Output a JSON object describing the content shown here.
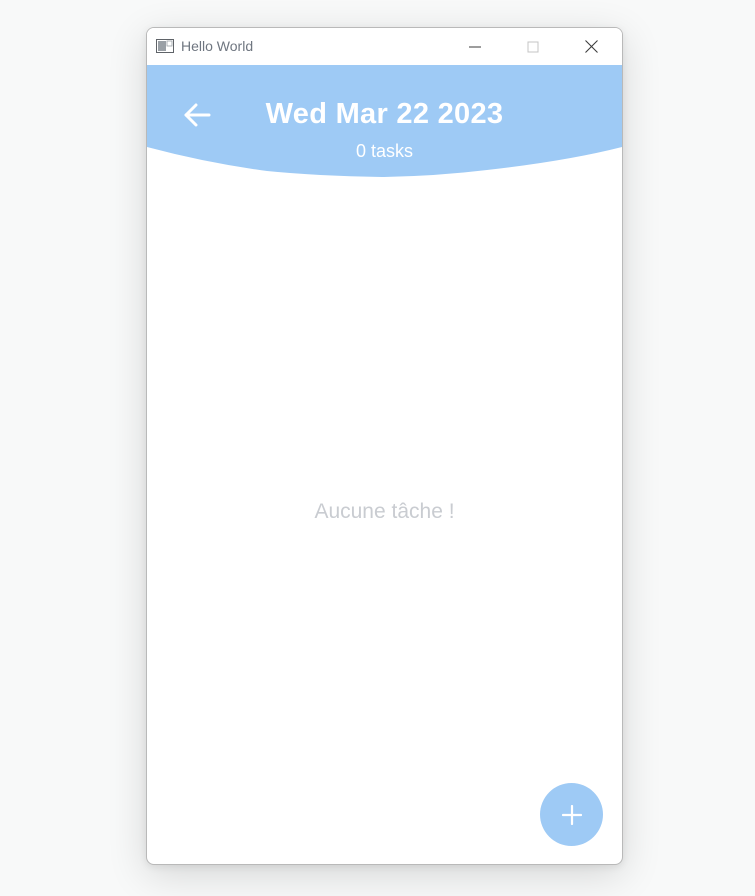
{
  "window": {
    "title": "Hello World",
    "icon": "app-window-icon"
  },
  "titlebar_buttons": {
    "minimize_icon": "minimize-icon",
    "maximize_icon": "maximize-icon",
    "close_icon": "close-icon"
  },
  "header": {
    "date": "Wed Mar 22 2023",
    "task_count": "0 tasks",
    "back_icon": "arrow-left-icon",
    "color": "#9ecaf5"
  },
  "main": {
    "empty_message": "Aucune tâche !"
  },
  "fab": {
    "icon": "plus-icon",
    "color": "#9ecaf5"
  }
}
